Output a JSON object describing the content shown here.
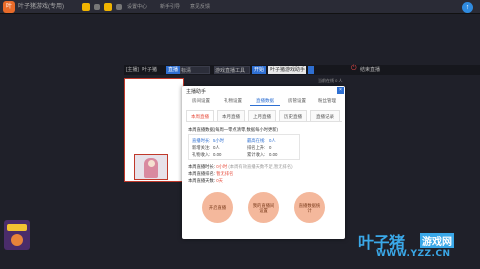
{
  "topbar": {
    "title": "叶子猪游戏(专用)",
    "level1": "0级",
    "level2": "0",
    "link_settings": "设置中心",
    "link_help": "新手引导",
    "link_feedback": "意见反馈",
    "upload_icon": "upload-icon"
  },
  "streambar": {
    "room_label": "[主播]",
    "room_name": "叶子猪",
    "mode_label": "直播",
    "quality_label": "标清",
    "title_value": "游戏直播工具",
    "start_btn": "开始",
    "select_value": "叶子猪游戏助手",
    "power_icon": "power-icon",
    "end_label": "结束直播",
    "info_text": "当前在线 0 人"
  },
  "dialog": {
    "title": "主播助手",
    "close_label": "×",
    "tabs_top": [
      "房间设置",
      "礼物设置",
      "直播数据",
      "房管设置",
      "粉丝管理"
    ],
    "tabs_top_active": 2,
    "tabs_sub": [
      "本周直播",
      "本月直播",
      "上月直播",
      "历史直播",
      "直播记录"
    ],
    "tabs_sub_active": 0,
    "desc": "本周直播数据(每周一零点清零,数据每小时更新)",
    "stats": {
      "duration_label": "直播时长:",
      "duration_value": "5小时",
      "fans_label": "新增关注:",
      "fans_value": "0人",
      "gifts_label": "礼物收入:",
      "gifts_value": "0.00",
      "viewers_label": "最高在线:",
      "viewers_value": "0人",
      "rank_label": "排名上升:",
      "rank_value": "0",
      "total_label": "累计收入:",
      "total_value": "0.00"
    },
    "line1_prefix": "本周直播时长:",
    "line1_value": "0小时",
    "line1_note": "(本周有效直播天数不足,暂无排名)",
    "line2_prefix": "本周直播排名:",
    "line2_value": "暂无排名",
    "line3_prefix": "本周直播天数:",
    "line3_value": "0天",
    "circles": [
      "开启直播",
      "我的直播间设置",
      "直播数据统计"
    ]
  },
  "watermark": {
    "brand": "叶子猪",
    "tag": "游戏网",
    "url": "WWW.YZZ.CN"
  }
}
